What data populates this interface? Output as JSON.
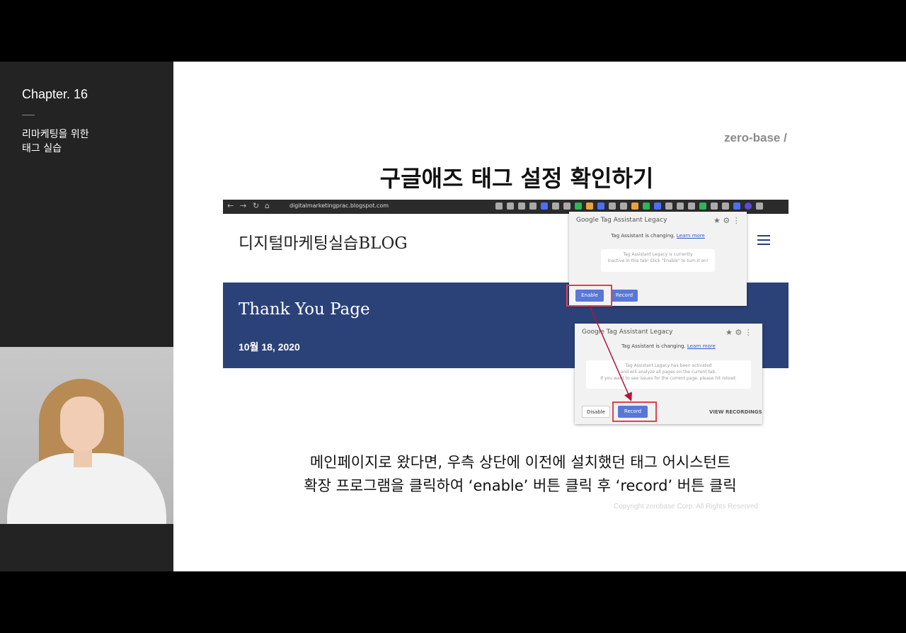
{
  "sidebar": {
    "chapter": "Chapter. 16",
    "subtitle_line1": "리마케팅을 위한",
    "subtitle_line2": "태그 실습"
  },
  "slide": {
    "logo": "zero-base /",
    "heading": "구글애즈 태그 설정 확인하기",
    "caption_line1": "메인페이지로 왔다면, 우측 상단에 이전에 설치했던 태그 어시스턴트",
    "caption_line2": "확장 프로그램을 클릭하여 ‘enable’ 버튼 클릭 후 ‘record’ 버튼 클릭",
    "copyright": "Copyright zerobase Corp. All Rights Reserved"
  },
  "browser": {
    "url": "digitalmarketingprac.blogspot.com",
    "blog_title": "디지털마케팅실습BLOG",
    "banner_title": "Thank You Page",
    "banner_date": "10월 18, 2020"
  },
  "popup1": {
    "title": "Google Tag Assistant Legacy",
    "status": "Tag Assistant is changing.",
    "learn_more": "Learn more",
    "message_line1": "Tag Assistant Legacy is currently",
    "message_line2": "inactive in this tab! Click \"Enable\" to turn it on!",
    "enable_label": "Enable",
    "record_label": "Record"
  },
  "popup2": {
    "title": "Google Tag Assistant Legacy",
    "status": "Tag Assistant is changing.",
    "learn_more": "Learn more",
    "message_line1": "Tag Assistant Legacy has been activated",
    "message_line2": "and will analyze all pages on the current tab.",
    "message_line3": "If you want to see issues for the current page, please hit reload.",
    "disable_label": "Disable",
    "record_label": "Record",
    "view_recordings": "VIEW RECORDINGS"
  },
  "colors": {
    "banner": "#2b4279",
    "highlight": "#e0414c",
    "button": "#5877d9"
  }
}
